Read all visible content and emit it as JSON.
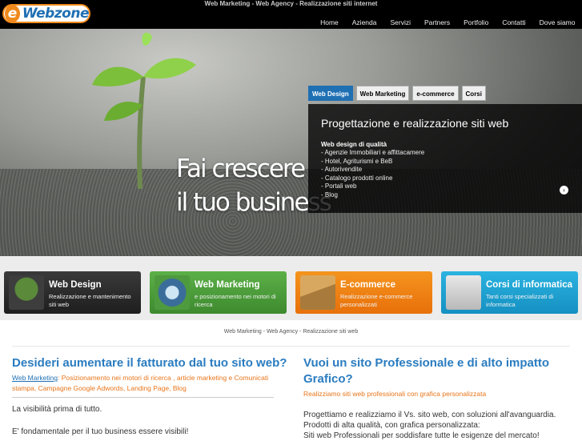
{
  "header": {
    "tagline": "Web Marketing - Web Agency - Realizzazione siti internet",
    "logo_text": "Webzone",
    "logo_letter": "e",
    "nav": [
      "Home",
      "Azienda",
      "Servizi",
      "Partners",
      "Portfolio",
      "Contatti",
      "Dove siamo"
    ]
  },
  "hero": {
    "line1": "Fai crescere",
    "line2": "il tuo business",
    "tabs": [
      "Web Design",
      "Web Marketing",
      "e-commerce",
      "Corsi"
    ],
    "panel": {
      "title": "Progettazione e realizzazione siti web",
      "subtitle": "Web design di qualità",
      "items": [
        "- Agenzie Immobiliari e affittacamere",
        "- Hotel, Agriturismi e BeB",
        "- Autorivendite",
        "- Catalogo prodotti online",
        "- Portali web",
        "- Blog"
      ],
      "arrow": "›"
    }
  },
  "services": [
    {
      "title": "Web Design",
      "desc": "Realizzazione e mantenimento siti web",
      "icon": "bonsai-icon",
      "color": "#2b2b2b"
    },
    {
      "title": "Web Marketing",
      "desc": "e posizionamento nei motori di ricerca",
      "icon": "globe-icon",
      "color": "#4a9a3a"
    },
    {
      "title": "E-commerce",
      "desc": "Realizzazione e-commerce personalizzati",
      "icon": "box-icon",
      "color": "#f07d12"
    },
    {
      "title": "Corsi di informatica",
      "desc": "Tanti corsi specializzati di informatica",
      "icon": "computer-icon",
      "color": "#1ea0cf"
    }
  ],
  "subhead": "Web Marketing - Web Agency - Realizzazione siti web",
  "left": {
    "heading": "Desideri aumentare il fatturato dal tuo sito web?",
    "link_label": "Web Marketing",
    "links_text": ": Posizionamento nei motori di ricerca , article marketing e Comunicati stampa, Campagne Google Adwords, Landing Page, Blog",
    "p1": "La visibilità prima di tutto.",
    "p2": "E' fondamentale per il tuo business essere visibili!"
  },
  "right": {
    "heading": "Vuoi un sito Professionale e di alto impatto Grafico?",
    "orange": "Realizziamo siti web professionali con grafica personalizzata",
    "p1": "Progettiamo e realizziamo il Vs. sito web, con soluzioni all'avanguardia.",
    "p2": "Prodotti di alta qualità, con grafica personalizzata:",
    "p3": "Siti web Professionali per soddisfare tutte le esigenze del mercato!"
  }
}
